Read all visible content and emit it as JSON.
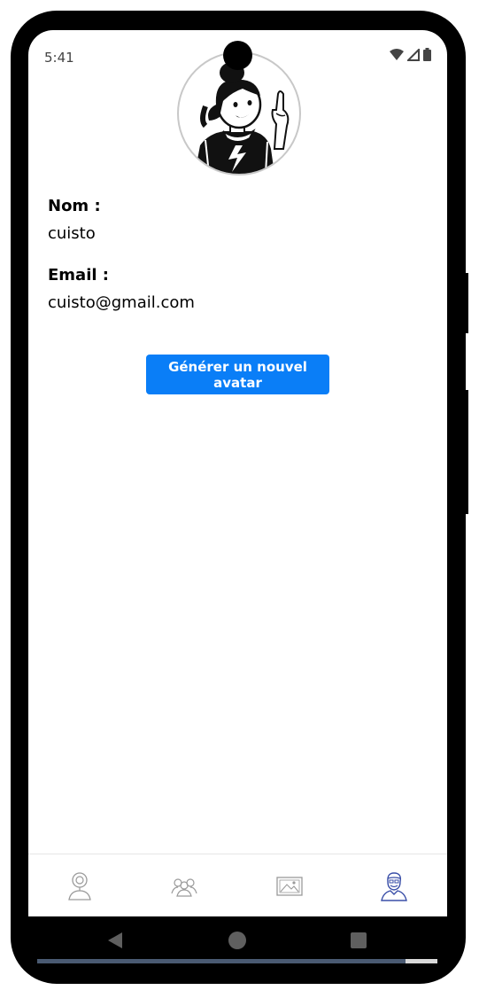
{
  "status_bar": {
    "time": "5:41",
    "icons": [
      "wifi-icon",
      "cell-signal-icon",
      "battery-icon"
    ]
  },
  "profile": {
    "avatar_icon": "avatar-illustration",
    "name_label": "Nom :",
    "name_value": "cuisto",
    "email_label": "Email :",
    "email_value": "cuisto@gmail.com"
  },
  "actions": {
    "generate_avatar_label": "Générer un nouvel avatar"
  },
  "tab_bar": {
    "tabs": [
      {
        "icon": "person-location-icon",
        "active": false
      },
      {
        "icon": "group-icon",
        "active": false
      },
      {
        "icon": "image-icon",
        "active": false
      },
      {
        "icon": "profile-icon",
        "active": true
      }
    ]
  },
  "nav_bar": {
    "buttons": [
      "back-icon",
      "home-icon",
      "recents-icon"
    ]
  },
  "colors": {
    "accent": "#0a7ef7",
    "active_tab": "#3a4fa8",
    "inactive_tab": "#9a9a9a"
  }
}
